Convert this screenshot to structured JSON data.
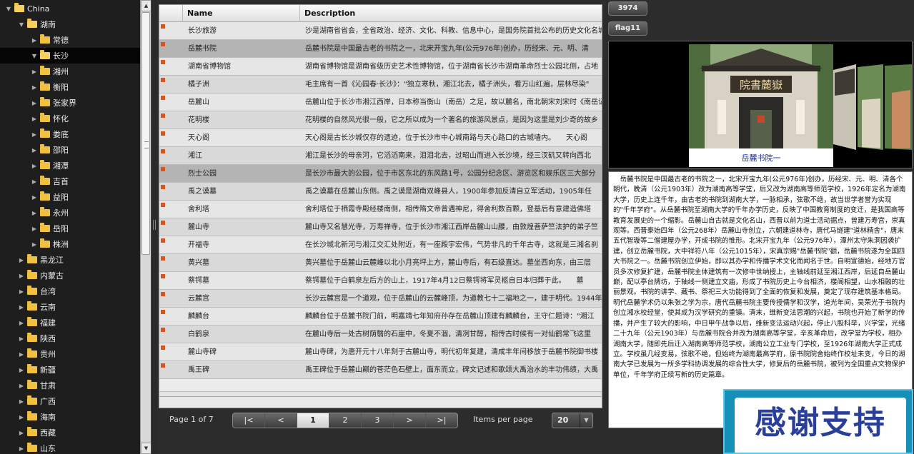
{
  "tree": {
    "root": {
      "label": "China",
      "expanded": true
    },
    "nodes": [
      {
        "label": "湖南",
        "level": 1,
        "expanded": true,
        "selected": false
      },
      {
        "label": "常德",
        "level": 2,
        "expanded": false,
        "selected": false
      },
      {
        "label": "长沙",
        "level": 2,
        "expanded": true,
        "selected": true
      },
      {
        "label": "湘州",
        "level": 2,
        "expanded": false,
        "selected": false
      },
      {
        "label": "衡阳",
        "level": 2,
        "expanded": false,
        "selected": false
      },
      {
        "label": "张家界",
        "level": 2,
        "expanded": false,
        "selected": false
      },
      {
        "label": "怀化",
        "level": 2,
        "expanded": false,
        "selected": false
      },
      {
        "label": "娄底",
        "level": 2,
        "expanded": false,
        "selected": false
      },
      {
        "label": "邵阳",
        "level": 2,
        "expanded": false,
        "selected": false
      },
      {
        "label": "湘潭",
        "level": 2,
        "expanded": false,
        "selected": false
      },
      {
        "label": "吉首",
        "level": 2,
        "expanded": false,
        "selected": false
      },
      {
        "label": "益阳",
        "level": 2,
        "expanded": false,
        "selected": false
      },
      {
        "label": "永州",
        "level": 2,
        "expanded": false,
        "selected": false
      },
      {
        "label": "岳阳",
        "level": 2,
        "expanded": false,
        "selected": false
      },
      {
        "label": "株洲",
        "level": 2,
        "expanded": false,
        "selected": false
      },
      {
        "label": "黑龙江",
        "level": 1,
        "expanded": false,
        "selected": false
      },
      {
        "label": "内蒙古",
        "level": 1,
        "expanded": false,
        "selected": false
      },
      {
        "label": "台湾",
        "level": 1,
        "expanded": false,
        "selected": false
      },
      {
        "label": "云南",
        "level": 1,
        "expanded": false,
        "selected": false
      },
      {
        "label": "福建",
        "level": 1,
        "expanded": false,
        "selected": false
      },
      {
        "label": "陕西",
        "level": 1,
        "expanded": false,
        "selected": false
      },
      {
        "label": "贵州",
        "level": 1,
        "expanded": false,
        "selected": false
      },
      {
        "label": "新疆",
        "level": 1,
        "expanded": false,
        "selected": false
      },
      {
        "label": "甘肃",
        "level": 1,
        "expanded": false,
        "selected": false
      },
      {
        "label": "广西",
        "level": 1,
        "expanded": false,
        "selected": false
      },
      {
        "label": "海南",
        "level": 1,
        "expanded": false,
        "selected": false
      },
      {
        "label": "西藏",
        "level": 1,
        "expanded": false,
        "selected": false
      },
      {
        "label": "山东",
        "level": 1,
        "expanded": false,
        "selected": false
      }
    ]
  },
  "grid": {
    "columns": [
      "Name",
      "Description"
    ],
    "rows": [
      {
        "name": "长沙旅游",
        "desc": "沙是湖南省省会，全省政治、经济、文化、科教、信息中心，是国务院首批公布的历史文化名城",
        "selected": false
      },
      {
        "name": "岳麓书院",
        "desc": "岳麓书院是中国最古老的书院之一，北宋开宝九年(公元976年)创办，历经宋、元、明、清",
        "selected": true
      },
      {
        "name": "湖南省博物馆",
        "desc": "湖南省博物馆是湖南省级历史艺术性博物馆，位于湖南省长沙市湖南革命烈士公园北侧，占地",
        "selected": false
      },
      {
        "name": "橘子洲",
        "desc": "毛主席有一首《沁园春·长沙》：\"独立寒秋，湘江北去，橘子洲头，看万山红遍，层林尽染\"",
        "selected": false
      },
      {
        "name": "岳麓山",
        "desc": "岳麓山位于长沙市湘江西岸，日本称当衡山（南岳）之足，故以麓名，南北朝宋刘宋时《南岳记》",
        "selected": false
      },
      {
        "name": "花明楼",
        "desc": "花明楼的自然风光很一般，它之所以成为一个著名的旅游风景点，是因为这里是刘少奇的故乡",
        "selected": false
      },
      {
        "name": "天心阁",
        "desc": "天心阁是古长沙城仅存的遗迹，位于长沙市中心城南路与天心路口的古城墙内。　　天心阁",
        "selected": false
      },
      {
        "name": "湘江",
        "desc": "湘江是长沙的母亲河，它滔滔南来，泪泪北去，过昭山而进入长沙境，经三汊矶又转向西北",
        "selected": false
      },
      {
        "name": "烈士公园",
        "desc": "是长沙市最大的公园，位于市区东北的东风路1号，公园分纪念区、游览区和娱乐区三大部分",
        "selected": true
      },
      {
        "name": "禹之谟墓",
        "desc": "禹之谟墓在岳麓山东侧。禹之谟是湖南双峰县人，1900年参加反清自立军活动，1905年任",
        "selected": false
      },
      {
        "name": "舍利塔",
        "desc": "舍利塔位于栖霞寺殿经楼南侧，相传隋文帝曾遇神尼，得舍利数百颗，登基后有意建造佛塔",
        "selected": false
      },
      {
        "name": "麓山寺",
        "desc": "麓山寺又名慧光寺，万寿禅寺，位于长沙市湘江西岸岳麓山山腰，由敦煌菩萨竺法护的弟子竺",
        "selected": false
      },
      {
        "name": "开福寺",
        "desc": "在长沙城北新河与湘江交汇处附近，有一座殿宇宏伟，气势非凡的千年古寺，这就是三湘名刹",
        "selected": false
      },
      {
        "name": "黄兴墓",
        "desc": "黄兴墓位于岳麓山云麓峰以北小月亮坪上方，麓山寺后，有石级直达。墓坐西向东，由三层",
        "selected": false
      },
      {
        "name": "蔡锷墓",
        "desc": "蔡锷墓位于白鹤泉左后方的山上，1917年4月12日蔡锷将军灵柩自日本归葬于此。　　墓",
        "selected": false
      },
      {
        "name": "云麓宫",
        "desc": "长沙云麓宫是一个道观，位于岳麓山的云麓峰顶，为道教七十二福地之一，建于明代。1944年",
        "selected": false
      },
      {
        "name": "麟麟台",
        "desc": "麟麟台位于岳麓书院门前，明嘉靖七年知府孙存在岳麓山顶建有麟麟台，王守仁题诗：\"湘江",
        "selected": false
      },
      {
        "name": "白鹤泉",
        "desc": "在麓山寺后一处古树荫翳的石崖中，冬夏不涸，清冽甘醇，相传古时候有一对仙鹤常飞这里",
        "selected": false
      },
      {
        "name": "麓山寺碑",
        "desc": "麓山寺碑，为唐开元十八年刻于古麓山寺，明代初年复建，清成丰年间移放于岳麓书院御书楼",
        "selected": false
      },
      {
        "name": "禹王碑",
        "desc": "禹王碑位于岳麓山巅的苍茫色石壁上，面东而立，碑文记述和歌颂大禹治水的丰功伟绩，大禹",
        "selected": false
      }
    ]
  },
  "pager": {
    "info": "Page 1 of 7",
    "first": "|<",
    "prev": "<",
    "pages": [
      "1",
      "2",
      "3"
    ],
    "current": "1",
    "next": ">",
    "last": ">|",
    "items_label": "Items per page",
    "items_value": "20"
  },
  "right": {
    "count_button": "3974",
    "flag_button": "flag11",
    "caption": "岳麓书院一",
    "sign_text": "院書麓嶽",
    "description": "　岳麓书院是中国最古老的书院之一，北宋开宝九年(公元976年)创办，历经宋、元、明、清各个朝代，晚清（公元1903年）改为湖南高等学堂，后又改为湖南高等师范学校，1926年定名为湖南大学，历史上连千年，由古老的书院到湖南大学，一脉相承，弦歌不绝，故当世学者誉为实现的\"千年学府\"。从岳麓书院至湖南大学的千年办学历史，反映了中国教育制度的变迁，是我国高等教育发展史的一个缩影。岳麓山自古就是文化名山，西晋以前为道士活动据点，曾建万寿宫，崇真观等。西晋泰始四年（公元268年）岳麓山寺创立，六朝建道林寺，唐代马燧建\"道林精舍\"，唐末五代智璇等二僧建屋办学，开成书院的惟形。北宋开宝九年（公元976年），潭州太守朱洞因袭扩建，创立岳麓书院，大中祥符八年（公元1015年），宋真宗赐\"岳麓书院\"额，岳麓书院遂为全国四大书院之一。岳麓书院创立伊始，即以其办学和传播学术文化而闻名于世。自明宣德始，经地方官员多次修复扩建，岳麓书院主体建筑有一次修中世纳授上，主轴线前延至湘江西岸，后延自岳麓山巅，配以亭台牌坊，于轴线一侧建立文庙，形成了书院历史上今台相济，楼阁相望，山水相融的壮丽景观。书院的讲学、藏书、祭祀三大功能得到了全面的恢复和发展，奠定了现存建筑基本格局。明代岳麓学术仍以朱张之学为宗，唐代岳麓书院主要传授儒学和汉学，道光年间，吴荣光于书院内创立湘水校经堂，使其成为汉学研究的重镇。清末，维新变法思潮的兴起，书院也开始了新学的传播，并产生了较大的影响，中日甲午战争以后，维新变法运动兴起，停止八股科举，兴学堂，光绪二十九年（公元1903年）与岳麓书院合并改为湖南高等学堂，辛亥革命后，改学堂为学校，相办湖南大学，随即先后迁入湖南高等师范学校，湖南公立工业专门学校，至1926年湖南大学正式成立。学校虽几经变易，弦歌不绝，但始终为湖南最高学府，原书院院舍始终作校址未变，今日的湖南大学已发展为一所多学科协调发展的综合性大学，修复后的岳麓书院，被列为全国重点文物保护单位，千年学府正续写新的历史篇章。",
    "thanks": "感谢支持"
  },
  "colors": {
    "row_marker": "#e0501a",
    "selected_row": "#b4b4b4",
    "tree_folder": "#f0c040",
    "thanks_bg": "#1590b8"
  }
}
